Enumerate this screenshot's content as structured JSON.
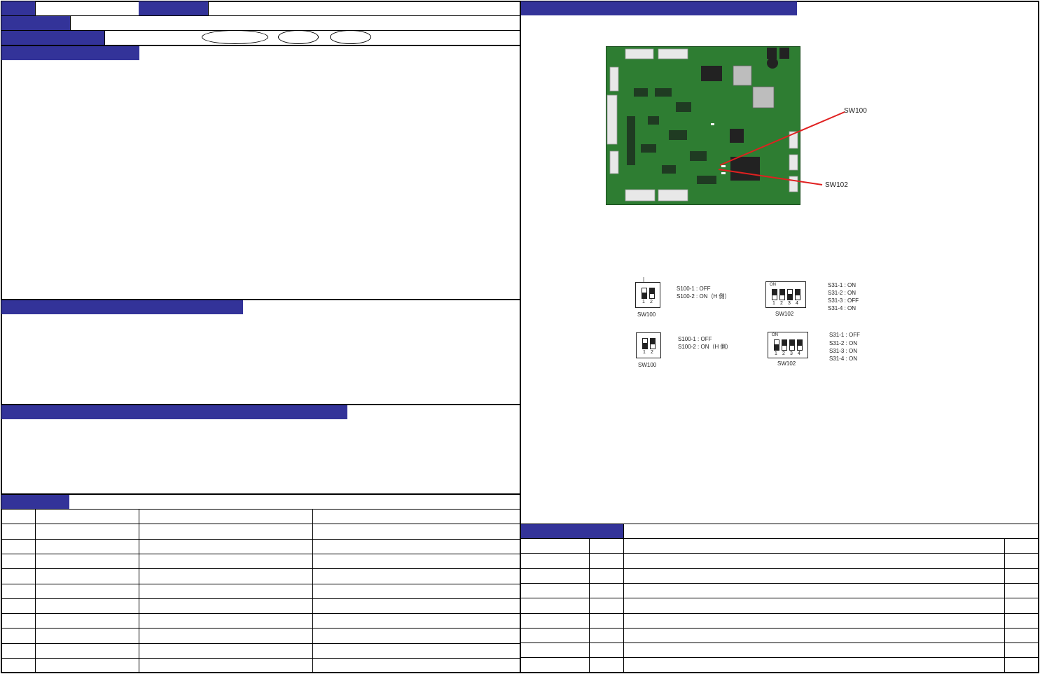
{
  "colors": {
    "header_bar": "#333399",
    "callout_line": "#e02020",
    "pcb_green": "#2e7d32"
  },
  "board_photo": {
    "callouts": [
      {
        "id": "sw100",
        "text": "SW100"
      },
      {
        "id": "sw102",
        "text": "SW102"
      }
    ]
  },
  "dip_settings": [
    {
      "sw100": {
        "label": "SW100",
        "pos_nums": [
          "1",
          "2"
        ],
        "states": [
          "OFF",
          "ON"
        ],
        "lines": [
          "S100-1 : OFF",
          "S100-2 : ON（H 側）"
        ]
      },
      "sw102": {
        "label": "SW102",
        "on_text": "ON",
        "pos_nums": [
          "1",
          "2",
          "3",
          "4"
        ],
        "states": [
          "ON",
          "ON",
          "OFF",
          "ON"
        ],
        "lines": [
          "S31-1 : ON",
          "S31-2 : ON",
          "S31-3 : OFF",
          "S31-4 : ON"
        ]
      }
    },
    {
      "sw100": {
        "label": "SW100",
        "pos_nums": [
          "1",
          "2"
        ],
        "states": [
          "OFF",
          "ON"
        ],
        "lines": [
          "S100-1 : OFF",
          "S100-2 : ON（H 側）"
        ]
      },
      "sw102": {
        "label": "SW102",
        "on_text": "ON",
        "pos_nums": [
          "1",
          "2",
          "3",
          "4"
        ],
        "states": [
          "OFF",
          "ON",
          "ON",
          "ON"
        ],
        "lines": [
          "S31-1 : OFF",
          "S31-2 : ON",
          "S31-3 : ON",
          "S31-4 : ON"
        ]
      }
    }
  ]
}
